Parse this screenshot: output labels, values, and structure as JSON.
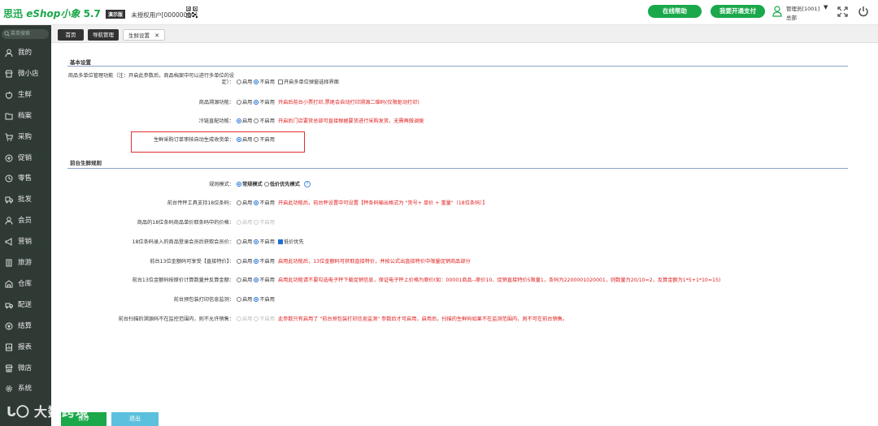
{
  "header": {
    "logo_brand": "思迅",
    "logo_product": "eShop小象",
    "logo_version": "5.7",
    "demo_badge": "演示版",
    "unauthorized_user": "未授权用户[00000000]",
    "online_help": "在线帮助",
    "open_payment": "我要开通支付",
    "user_name": "管理员[1001]",
    "user_shop": "总部",
    "caret": "▼"
  },
  "sidebar": {
    "search_placeholder": "菜单搜索",
    "items": [
      {
        "label": "我的",
        "icon": "user-icon"
      },
      {
        "label": "微小店",
        "icon": "shop-icon"
      },
      {
        "label": "生鲜",
        "icon": "apple-icon"
      },
      {
        "label": "档案",
        "icon": "folder-icon"
      },
      {
        "label": "采购",
        "icon": "cart-icon"
      },
      {
        "label": "促销",
        "icon": "gift-icon"
      },
      {
        "label": "零售",
        "icon": "clock-icon"
      },
      {
        "label": "批发",
        "icon": "truck-icon"
      },
      {
        "label": "会员",
        "icon": "member-icon"
      },
      {
        "label": "营销",
        "icon": "megaphone-icon"
      },
      {
        "label": "旅游",
        "icon": "document-icon"
      },
      {
        "label": "仓库",
        "icon": "warehouse-icon"
      },
      {
        "label": "配送",
        "icon": "delivery-icon"
      },
      {
        "label": "结算",
        "icon": "money-icon"
      },
      {
        "label": "报表",
        "icon": "report-icon"
      },
      {
        "label": "微店",
        "icon": "store-icon"
      },
      {
        "label": "系统",
        "icon": "gear-icon"
      }
    ]
  },
  "tabs": [
    {
      "label": "首页"
    },
    {
      "label": "导航管理"
    },
    {
      "label": "生鲜设置",
      "close": "✕"
    }
  ],
  "sections": {
    "basic": "基本设置",
    "front": "前台生鲜规则"
  },
  "rows": {
    "multi_unit": {
      "label": "商品多单位管理功能（注：开启此参数后，商品档案中可以进行多单位的设定）：",
      "on": "启用",
      "off": "不启用",
      "checkbox": "开启多单位弹窗选择界面"
    },
    "trace": {
      "label": "商品溯源功能：",
      "on": "启用",
      "off": "不启用",
      "note": "开启后前台小票打印,票尾会自动打印溯源二维码(仅限驱动打印)"
    },
    "cold_chain": {
      "label": "冷链直配功能：",
      "on": "启用",
      "off": "不启用",
      "note": "开启后门店要货总部可直接根据要货进行采购发货，无需再做调拨"
    },
    "auto_receipt": {
      "label": "生鲜采购订单审核自动生成收货单：",
      "on": "启用",
      "off": "不启用"
    },
    "rule_mode": {
      "label": "规则模式：",
      "normal": "常规模式",
      "low": "低价优先模式",
      "help": "?"
    },
    "scale_18": {
      "label": "前台传秤工具支持18位条码：",
      "on": "启用",
      "off": "不启用",
      "note": "开启此功能后，前台秤设置中可设置【秤条码输出格式为 \"货号+ 单价 + 重量\"（18位条码）】"
    },
    "barcode_price": {
      "label": "商品的18位条码商品单价取条码中的价格：",
      "on": "启用",
      "off": "不启用"
    },
    "member_price": {
      "label": "18位条码录入的商品登录会员后获取会员价：",
      "on": "启用",
      "off": "不启用",
      "checkbox": "低价优先"
    },
    "special_13": {
      "label": "前台13位金额码可享受【直接特价】：",
      "on": "启用",
      "off": "不启用",
      "note": "启用此功能后，13位金额码可获取直接特价，并按公式出直接特价中限量促销商品部分"
    },
    "calc_13": {
      "label": "前台13位金额码按原价计算数量并反算金额：",
      "on": "启用",
      "off": "不启用",
      "note": "启用此功能请不要勾选电子秤下载促销信息，保证电子秤上价格为原价(如：00001商品--原价10、促销直接特价5限量1，条码为2200001020001，则数量为20/10=2，反算金额为1*5+1*10=15)"
    },
    "prepack_monitor": {
      "label": "前台预包装打印信息监测：",
      "on": "启用",
      "off": "不启用"
    },
    "trace_scan": {
      "label": "前台扫描的溯源码不在监控范围内，则不允许销售：",
      "on": "启用",
      "off": "不启用",
      "note": "此参数只有启用了 \"前台预包装打印信息监测\" 参数后才可启用，启用后，扫描的生鲜码如果不在监测范围内，则不可在前台销售。"
    }
  },
  "footer": {
    "save": "保存",
    "back": "退出"
  },
  "watermark": {
    "mark": "ᒐ〇",
    "text": "大数跨境"
  },
  "colors": {
    "brand_green": "#1aa84a",
    "sidebar_bg": "#2f3a35",
    "note_red": "#e02020",
    "radio_blue": "#1e6fd6",
    "highlight_box": "#e03030"
  }
}
